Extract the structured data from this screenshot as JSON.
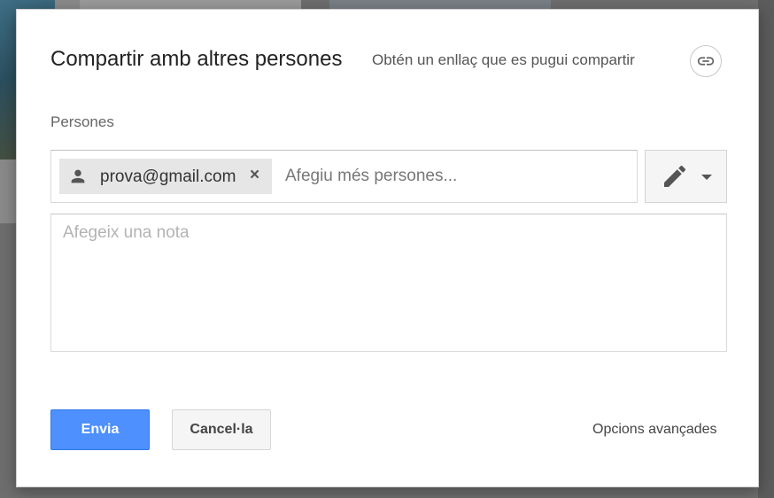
{
  "dialog": {
    "title": "Compartir amb altres persones",
    "get_link_label": "Obtén un enllaç que es pugui compartir",
    "link_icon": "link-icon"
  },
  "people": {
    "label": "Persones",
    "chips": [
      {
        "email": "prova@gmail.com",
        "icon": "person-icon",
        "remove_label": "×"
      }
    ],
    "input_placeholder": "Afegiu més persones...",
    "permission_icon": "pencil-icon",
    "dropdown_icon": "caret-down-icon"
  },
  "note": {
    "placeholder": "Afegeix una nota"
  },
  "actions": {
    "send_label": "Envia",
    "cancel_label": "Cancel·la",
    "advanced_label": "Opcions avançades"
  },
  "colors": {
    "primary": "#4d90fe",
    "chip_bg": "#e6e6e6"
  }
}
